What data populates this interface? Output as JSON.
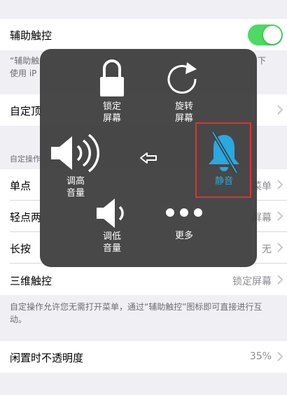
{
  "assistive_touch": {
    "label": "辅助触控",
    "enabled": true
  },
  "note_top": {
    "left": "“辅助触",
    "left2": "使用 iP",
    "right": "下"
  },
  "customize_top": {
    "label": "自定顶"
  },
  "custom_actions_header": "自定操作",
  "single_tap": {
    "label": "单点",
    "value": "菜单"
  },
  "double_tap": {
    "label": "轻点两",
    "value": "屏幕"
  },
  "long_press": {
    "label": "长按",
    "value": "无"
  },
  "three_d_touch": {
    "label": "三维触控",
    "value": "锁定屏幕"
  },
  "custom_actions_note": "自定操作允许您无需打开菜单，通过“辅助触控”图标即可直接进行互动。",
  "idle_opacity": {
    "label": "闲置时不透明度",
    "value": "35%"
  },
  "menu": {
    "lock_screen": [
      "锁定",
      "屏幕"
    ],
    "rotate_screen": [
      "旋转",
      "屏幕"
    ],
    "volume_up": [
      "调高",
      "音量"
    ],
    "mute": "静音",
    "volume_down": [
      "调低",
      "音量"
    ],
    "more": "更多"
  },
  "colors": {
    "toggle_on": "#4cd964",
    "mute_accent": "#2aa8e0",
    "highlight_box": "#dd3333"
  }
}
